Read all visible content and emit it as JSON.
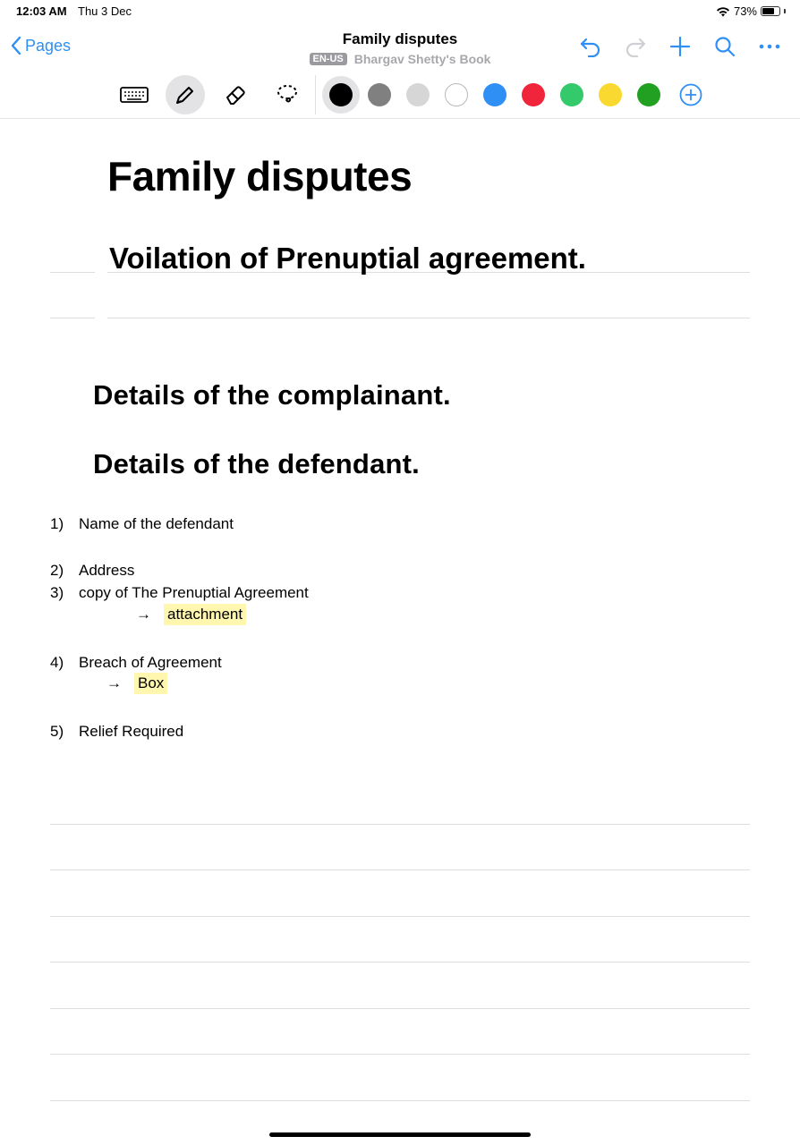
{
  "status_bar": {
    "time": "12:03 AM",
    "date": "Thu 3 Dec",
    "battery": "73%"
  },
  "nav": {
    "back_label": "Pages",
    "title": "Family disputes",
    "language": "EN-US",
    "book": "Bhargav Shetty's Book"
  },
  "toolbar": {
    "tools": [
      "keyboard-icon",
      "pen-icon",
      "eraser-icon",
      "lasso-icon"
    ],
    "colors": [
      "#000000",
      "#808080",
      "#d6d6d6",
      "#ffffff",
      "#2f8ff4",
      "#f0243a",
      "#34c96b",
      "#f9d92f",
      "#22a022"
    ],
    "selected_color": "#000000",
    "accent": "#2f8ff4"
  },
  "page": {
    "title": "Family disputes",
    "case_title": "Voilation of Prenuptial agreement.",
    "complainant_heading": "Details of the complainant.",
    "defendant_heading": "Details of the defendant.",
    "items": [
      {
        "num": "1)",
        "text": "Name of the defendant"
      },
      {
        "num": "2)",
        "text": "Address"
      },
      {
        "num": "3)",
        "text": "copy of The Prenuptial Agreement"
      },
      {
        "num": "4)",
        "text": "Breach of Agreement"
      },
      {
        "num": "5)",
        "text": "Relief Required"
      }
    ],
    "sub_items": [
      {
        "arrow": "→",
        "text": "attachment"
      },
      {
        "arrow": "→",
        "text": "Box"
      }
    ],
    "highlight_color": "#fff6b0"
  }
}
